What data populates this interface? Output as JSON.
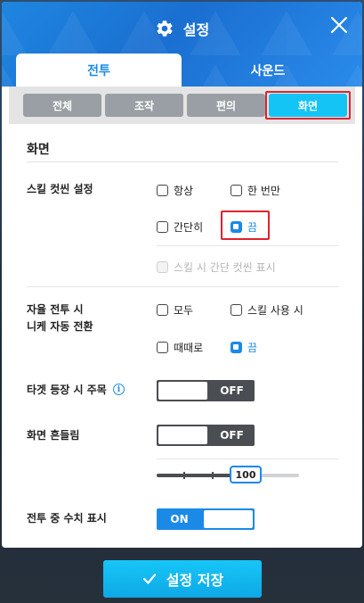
{
  "header": {
    "title": "설정",
    "close_icon": "close-icon",
    "settings_icon": "gear-icon"
  },
  "tabs": [
    {
      "label": "전투",
      "active": true
    },
    {
      "label": "사운드",
      "active": false
    }
  ],
  "subtabs": [
    {
      "label": "전체",
      "active": false
    },
    {
      "label": "조작",
      "active": false
    },
    {
      "label": "편의",
      "active": false
    },
    {
      "label": "화면",
      "active": true
    }
  ],
  "section": {
    "title": "화면"
  },
  "skill_cutscene": {
    "label": "스킬 컷씬 설정",
    "options": [
      {
        "label": "항상",
        "checked": false
      },
      {
        "label": "한 번만",
        "checked": false
      },
      {
        "label": "간단히",
        "checked": false
      },
      {
        "label": "끔",
        "checked": true
      }
    ],
    "sub_option": {
      "label": "스킬 시 간단 컷씬 표시",
      "checked": false,
      "disabled": true
    }
  },
  "auto_battle": {
    "label_line1": "자율 전투 시",
    "label_line2": "니케 자동 전환",
    "options": [
      {
        "label": "모두",
        "checked": false
      },
      {
        "label": "스킬 사용 시",
        "checked": false
      },
      {
        "label": "때때로",
        "checked": false
      },
      {
        "label": "끔",
        "checked": true
      }
    ]
  },
  "target_focus": {
    "label": "타겟 등장 시 주목",
    "info_icon": "info-icon",
    "toggle_label": "OFF",
    "on": false
  },
  "screen_shake": {
    "label": "화면 흔들림",
    "toggle_label": "OFF",
    "on": false,
    "slider_value": "100"
  },
  "damage_display": {
    "label": "전투 중 수치 표시",
    "toggle_label": "ON",
    "on": true
  },
  "footer": {
    "save_label": "설정 저장",
    "check_icon": "check-icon"
  },
  "colors": {
    "accent": "#1a8ae6",
    "active_subtab": "#13c4f5",
    "highlight": "#e0222e"
  }
}
